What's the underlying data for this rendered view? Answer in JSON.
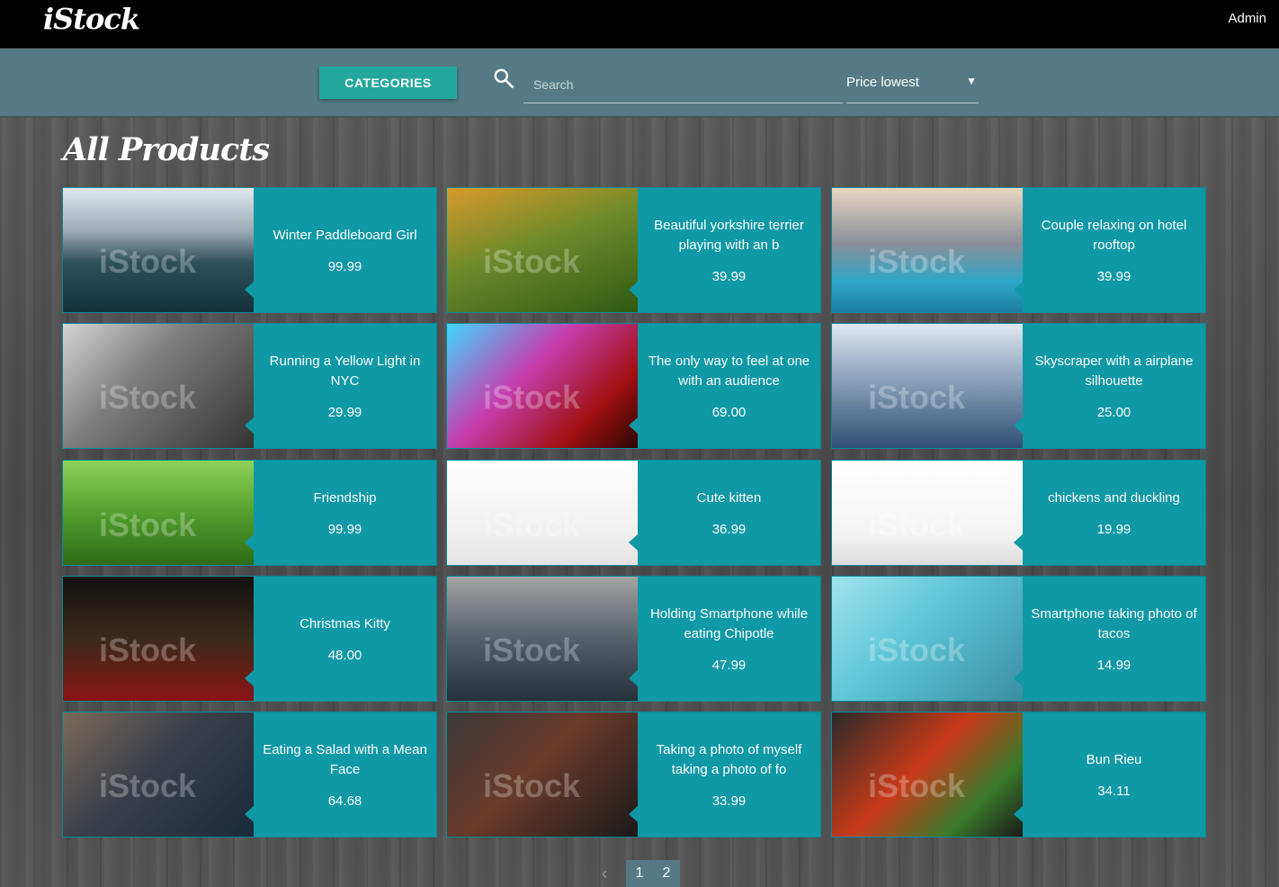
{
  "header": {
    "logo": "iStock",
    "user": "Admin"
  },
  "toolbar": {
    "categories_label": "CATEGORIES",
    "search_placeholder": "Search",
    "sort_value": "Price lowest",
    "sort_arrow": "▼"
  },
  "page": {
    "title": "All Products"
  },
  "watermark": "iStock",
  "products": [
    {
      "name": "Winter Paddleboard Girl",
      "price": "99.99"
    },
    {
      "name": "Beautiful yorkshire terrier playing with an b",
      "price": "39.99"
    },
    {
      "name": "Couple relaxing on hotel rooftop",
      "price": "39.99"
    },
    {
      "name": "Running a Yellow Light in NYC",
      "price": "29.99"
    },
    {
      "name": "The only way to feel at one with an audience",
      "price": "69.00"
    },
    {
      "name": "Skyscraper with a airplane silhouette",
      "price": "25.00"
    },
    {
      "name": "Friendship",
      "price": "99.99"
    },
    {
      "name": "Cute kitten",
      "price": "36.99"
    },
    {
      "name": "chickens and duckling",
      "price": "19.99"
    },
    {
      "name": "Christmas Kitty",
      "price": "48.00"
    },
    {
      "name": "Holding Smartphone while eating Chipotle",
      "price": "47.99"
    },
    {
      "name": "Smartphone taking photo of tacos",
      "price": "14.99"
    },
    {
      "name": "Eating a Salad with a Mean Face",
      "price": "64.68"
    },
    {
      "name": "Taking a photo of myself taking a photo of fo",
      "price": "33.99"
    },
    {
      "name": "Bun Rieu",
      "price": "34.11"
    }
  ],
  "pagination": {
    "prev": "‹",
    "pages": [
      "1",
      "2"
    ]
  }
}
